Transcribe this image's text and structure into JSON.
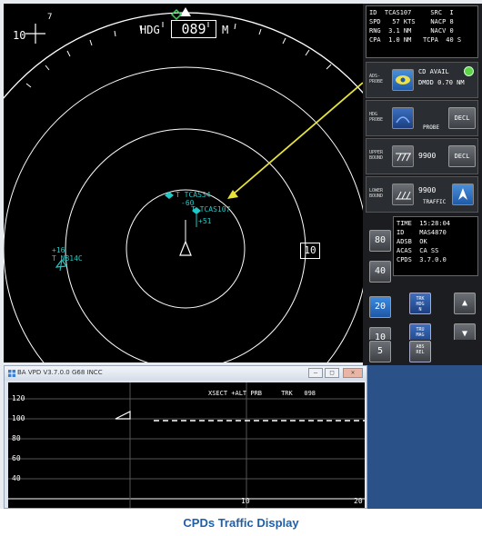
{
  "radar": {
    "heading_label": "HDG",
    "heading_value": "089",
    "heading_unit": "M",
    "range_value": "10",
    "scale_top_left": "10",
    "scale_small": "7",
    "targets": [
      {
        "lines": [
          "T TCAS34",
          "-60"
        ]
      },
      {
        "lines": [
          "T TCAS107",
          "+51"
        ]
      },
      {
        "lines": [
          "+16",
          "T N814C"
        ]
      }
    ],
    "colors": {
      "target": "#21c9c6",
      "arrow": "#e8e33a",
      "rings": "#ffffff"
    }
  },
  "panel": {
    "info_top": [
      "ID  TCAS107     SRC  I",
      "SPD   57 KTS    NACP 8",
      "RNG  3.1 NM     NACV 0",
      "CPA  1.0 NM   TCPA  40 S"
    ],
    "adsb_probe": {
      "label_lines": [
        "ADS-",
        "PROBE"
      ],
      "status": "CD AVAIL",
      "dmod": "DMOD 0.70 NM"
    },
    "hdg_probe": {
      "label_lines": [
        "HDG",
        "PROBE"
      ],
      "sub": "PROBE",
      "decl": "DECL"
    },
    "upper_bound": {
      "label_lines": [
        "UPPER",
        "BOUND"
      ],
      "value": "9900",
      "decl": "DECL"
    },
    "lower_bound": {
      "label_lines": [
        "LOWER",
        "BOUND"
      ],
      "value": "9900",
      "sub": "TRAFFIC"
    },
    "info_bottom": [
      "TIME  15:28:04",
      "ID    MAS4870",
      "ADSB  OK",
      "ACAS  CA SS",
      "CPDS  3.7.0.0"
    ],
    "range_buttons": [
      "80",
      "40",
      "20",
      "10",
      "5"
    ],
    "selected_range": "20",
    "mode_buttons": [
      {
        "lines": [
          "TRK",
          "HDG",
          "N"
        ]
      },
      {
        "lines": [
          "TRU",
          "MAG"
        ]
      },
      {
        "lines": [
          "ABS",
          "REL"
        ]
      }
    ],
    "arrows": {
      "up": "▲",
      "down": "▼"
    }
  },
  "vpd": {
    "title": "BA VPD V3.7.0.0 G68 INCC",
    "header": "XSECT +ALT PRB     TRK   098",
    "y_ticks": [
      "120",
      "100",
      "80",
      "60",
      "40"
    ],
    "x_ticks": [
      "10",
      "20"
    ],
    "window_controls": {
      "minimize": "–",
      "maximize": "□",
      "close": "✕"
    }
  },
  "caption": "CPDs Traffic Display"
}
